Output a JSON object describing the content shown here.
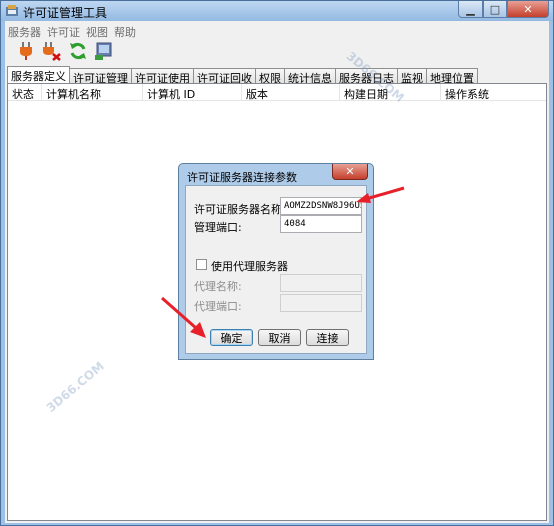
{
  "window": {
    "title": "许可证管理工具"
  },
  "menu": [
    "服务器",
    "许可证",
    "视图",
    "帮助"
  ],
  "toolbar": {
    "icons": [
      "plug-connect-icon",
      "plug-disconnect-icon",
      "refresh-icon",
      "server-config-icon"
    ]
  },
  "tabs": [
    "服务器定义",
    "许可证管理",
    "许可证使用",
    "许可证回收",
    "权限",
    "统计信息",
    "服务器日志",
    "监视",
    "地理位置"
  ],
  "grid": {
    "columns": [
      "状态",
      "计算机名称",
      "计算机 ID",
      "版本",
      "构建日期",
      "操作系统"
    ]
  },
  "dialog": {
    "title": "许可证服务器连接参数",
    "server_name_label": "许可证服务器名称:",
    "server_name_value": "AOMZ2DSNW8J96U5",
    "port_label": "管理端口:",
    "port_value": "4084",
    "use_proxy_label": "使用代理服务器",
    "proxy_name_label": "代理名称:",
    "proxy_port_label": "代理端口:",
    "ok_label": "确定",
    "cancel_label": "取消",
    "connect_label": "连接"
  },
  "colors": {
    "accent_arrow": "#e8202a",
    "titlebar": "#9cc0e6"
  }
}
